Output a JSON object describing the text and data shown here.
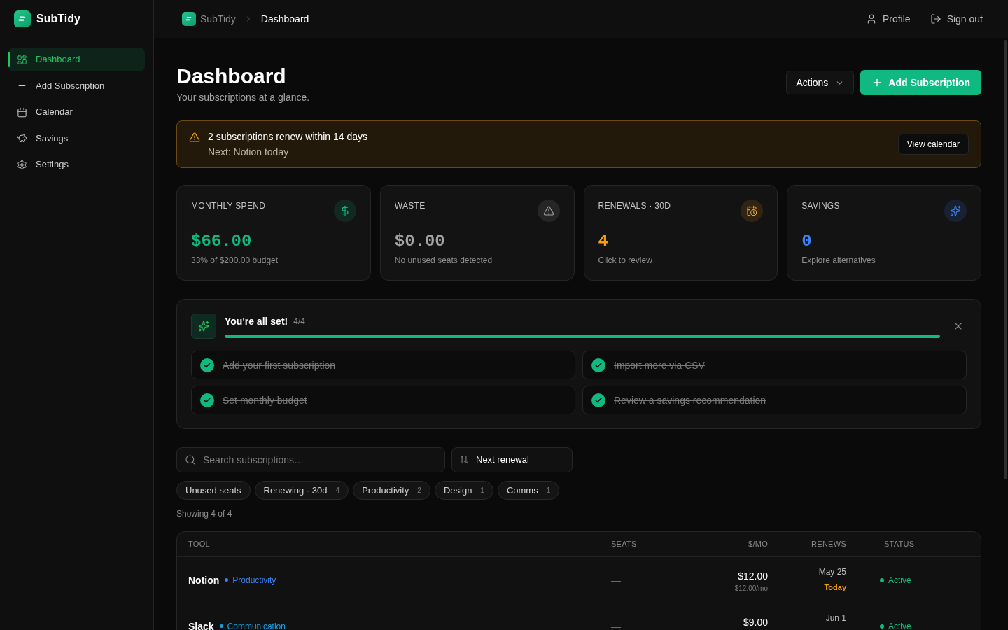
{
  "brand": {
    "name": "SubTidy"
  },
  "sidebar": {
    "items": [
      {
        "label": "Dashboard",
        "selected": true
      },
      {
        "label": "Add Subscription",
        "selected": false
      },
      {
        "label": "Calendar",
        "selected": false
      },
      {
        "label": "Savings",
        "selected": false
      },
      {
        "label": "Settings",
        "selected": false
      }
    ]
  },
  "header": {
    "breadcrumb": [
      {
        "label": "SubTidy"
      },
      {
        "label": "Dashboard"
      }
    ],
    "links": [
      {
        "label": "Profile"
      },
      {
        "label": "Sign out"
      }
    ]
  },
  "page": {
    "title": "Dashboard",
    "subtitle": "Your subscriptions at a glance.",
    "buttons": [
      {
        "label": "Actions",
        "kind": "menu"
      },
      {
        "label": "Add Subscription",
        "kind": "primary"
      }
    ]
  },
  "alert": {
    "title": "2 subscriptions renew within 14 days",
    "detail": "Next: Notion today",
    "button": "View calendar"
  },
  "stats": [
    {
      "label": "MONTHLY SPEND",
      "value": "$66.00",
      "caption": "33% of $200.00 budget",
      "color": "#10b981"
    },
    {
      "label": "WASTE",
      "value": "$0.00",
      "caption": "No unused seats detected",
      "color": "#a3a3a3"
    },
    {
      "label": "RENEWALS · 30D",
      "value": "4",
      "caption": "Click to review",
      "color": "#f59e0b"
    },
    {
      "label": "SAVINGS",
      "value": "0",
      "caption": "Explore alternatives",
      "color": "#3b82f6"
    }
  ],
  "checklist": {
    "title": "You're all set!",
    "count": "4/4",
    "level": 1,
    "items": [
      {
        "label": "Add your first subscription",
        "checked": true
      },
      {
        "label": "Import more via CSV",
        "checked": true
      },
      {
        "label": "Set monthly budget",
        "checked": true
      },
      {
        "label": "Review a savings recommendation",
        "checked": true
      }
    ]
  },
  "search": {
    "placeholder": "Search subscriptions…"
  },
  "sort": {
    "label": "Next renewal"
  },
  "filters": [
    {
      "label": "Unused seats",
      "selected": false
    },
    {
      "label": "Renewing · 30d",
      "count": "4",
      "selected": false
    },
    {
      "label": "Productivity",
      "count": "2",
      "selected": false
    },
    {
      "label": "Design",
      "count": "1",
      "selected": false
    },
    {
      "label": "Comms",
      "count": "1",
      "selected": false
    }
  ],
  "result_count": "Showing 4 of 4",
  "table": {
    "columns": [
      "TOOL",
      "SEATS",
      "$/MO",
      "RENEWS",
      "STATUS"
    ],
    "rows": [
      {
        "tool": "Notion",
        "category": "Productivity",
        "color": "#3b82f6",
        "seats": "—",
        "price": "$12.00",
        "price_detail": "$12.00/mo",
        "renews": "May 25",
        "renews_note": "Today",
        "status": "Active"
      },
      {
        "tool": "Slack",
        "category": "Communication",
        "color": "#0ea5e9",
        "seats": "—",
        "price": "$9.00",
        "renews": "Jun 1",
        "status": "Active"
      }
    ]
  }
}
